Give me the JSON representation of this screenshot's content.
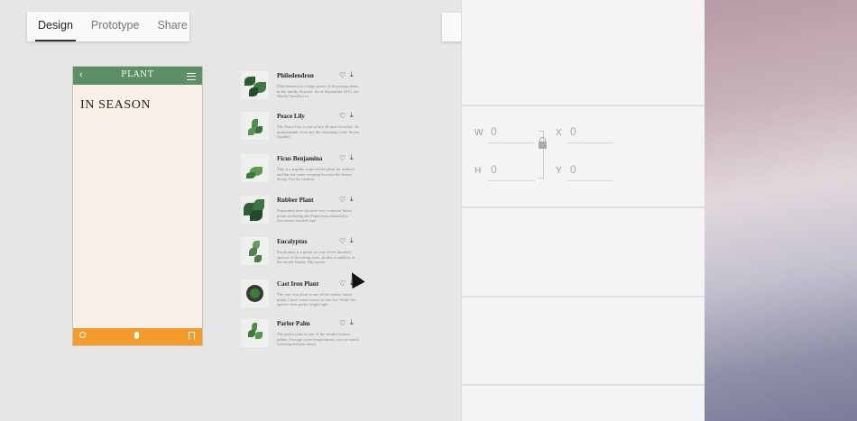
{
  "tabs": [
    {
      "label": "Design",
      "active": true
    },
    {
      "label": "Prototype",
      "active": false
    },
    {
      "label": "Share",
      "active": false
    }
  ],
  "player": {
    "record_icon": "circle-icon",
    "stop_icon": "rect-icon",
    "play_icon": "play-icon"
  },
  "phone": {
    "header_title": "PLANT",
    "back_glyph": "‹",
    "season_title": "IN SEASON",
    "header_color": "#5d8f67",
    "footer_color": "#f39b2b",
    "footer_icons": [
      "search-icon",
      "mic-icon",
      "bookmark-icon"
    ]
  },
  "plants": [
    {
      "name": "Philodendron",
      "desc": "Philodendron is a large genus of flowering plants in the family Araceae. As of September 2015, the World Checklist of"
    },
    {
      "name": "Peace Lily",
      "desc": "The Peace Lily is one of my all time favorites. Its unmistakable look and the charming white flower (spathe)"
    },
    {
      "name": "Ficus Benjamina",
      "desc": "This is a popular tropical tree plant for indoors and has the same weeping because the leaves droop. For the modern"
    },
    {
      "name": "Rubber Plant",
      "desc": "Peperomia have become very common house plants including the Peperomia obtusifolia. Succulent rounded type"
    },
    {
      "name": "Eucalyptus",
      "desc": "Eucalyptus is a genus of over seven hundred species of flowering trees, shrubs or mallees in the myrtle family, Myrtaceae"
    },
    {
      "name": "Cast Iron Plant",
      "desc": "The cast iron plant is one of the easiest house plants I have come across to care for. While this species does prefer bright light"
    },
    {
      "name": "Parlor Palm",
      "desc": "The parlor palm is one of the smaller indoor palms. Average room temperatures, not too much watering and just about"
    }
  ],
  "icons": {
    "heart": "♡",
    "download": "⤓"
  },
  "inspector": {
    "w_label": "W",
    "w_value": "0",
    "h_label": "H",
    "h_value": "0",
    "x_label": "X",
    "x_value": "0",
    "y_label": "Y",
    "y_value": "0"
  }
}
